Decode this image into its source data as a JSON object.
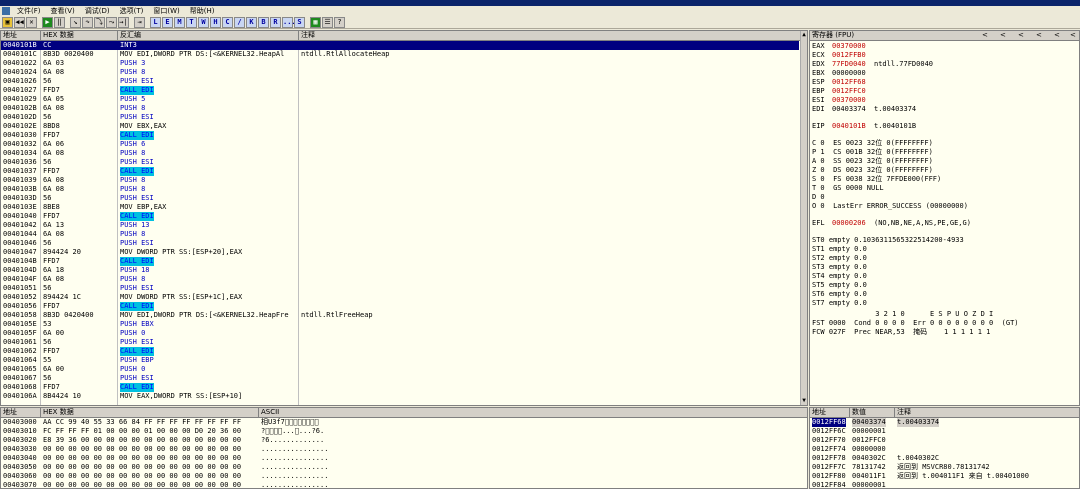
{
  "menu": {
    "items": [
      "文件(F)",
      "查看(V)",
      "调试(D)",
      "选项(T)",
      "窗口(W)",
      "帮助(H)"
    ]
  },
  "toolbar": {
    "letters": [
      "L",
      "E",
      "M",
      "T",
      "W",
      "H",
      "C",
      "/",
      "K",
      "B",
      "R",
      "...",
      "S"
    ]
  },
  "disasm": {
    "headers": [
      "地址",
      "HEX 数据",
      "反汇编",
      "注释"
    ],
    "rows": [
      {
        "addr": "0040101B",
        "hex": "CC",
        "asm": "INT3",
        "comment": "",
        "selected": true
      },
      {
        "addr": "0040101C",
        "hex": "8B3D 0020400",
        "asm": "MOV EDI,DWORD PTR DS:[<&KERNEL32.HeapAl",
        "comment": "ntdll.RtlAllocateHeap"
      },
      {
        "addr": "00401022",
        "hex": "6A 03",
        "asm": "PUSH 3",
        "comment": ""
      },
      {
        "addr": "00401024",
        "hex": "6A 08",
        "asm": "PUSH 8",
        "comment": ""
      },
      {
        "addr": "00401026",
        "hex": "56",
        "asm": "PUSH ESI",
        "comment": ""
      },
      {
        "addr": "00401027",
        "hex": "FFD7",
        "asm": "CALL EDI",
        "comment": ""
      },
      {
        "addr": "00401029",
        "hex": "6A 05",
        "asm": "PUSH 5",
        "comment": ""
      },
      {
        "addr": "0040102B",
        "hex": "6A 08",
        "asm": "PUSH 8",
        "comment": ""
      },
      {
        "addr": "0040102D",
        "hex": "56",
        "asm": "PUSH ESI",
        "comment": ""
      },
      {
        "addr": "0040102E",
        "hex": "8BD8",
        "asm": "MOV EBX,EAX",
        "comment": ""
      },
      {
        "addr": "00401030",
        "hex": "FFD7",
        "asm": "CALL EDI",
        "comment": ""
      },
      {
        "addr": "00401032",
        "hex": "6A 06",
        "asm": "PUSH 6",
        "comment": ""
      },
      {
        "addr": "00401034",
        "hex": "6A 08",
        "asm": "PUSH 8",
        "comment": ""
      },
      {
        "addr": "00401036",
        "hex": "56",
        "asm": "PUSH ESI",
        "comment": ""
      },
      {
        "addr": "00401037",
        "hex": "FFD7",
        "asm": "CALL EDI",
        "comment": ""
      },
      {
        "addr": "00401039",
        "hex": "6A 08",
        "asm": "PUSH 8",
        "comment": ""
      },
      {
        "addr": "0040103B",
        "hex": "6A 08",
        "asm": "PUSH 8",
        "comment": ""
      },
      {
        "addr": "0040103D",
        "hex": "56",
        "asm": "PUSH ESI",
        "comment": ""
      },
      {
        "addr": "0040103E",
        "hex": "8BE8",
        "asm": "MOV EBP,EAX",
        "comment": ""
      },
      {
        "addr": "00401040",
        "hex": "FFD7",
        "asm": "CALL EDI",
        "comment": ""
      },
      {
        "addr": "00401042",
        "hex": "6A 13",
        "asm": "PUSH 13",
        "comment": ""
      },
      {
        "addr": "00401044",
        "hex": "6A 08",
        "asm": "PUSH 8",
        "comment": ""
      },
      {
        "addr": "00401046",
        "hex": "56",
        "asm": "PUSH ESI",
        "comment": ""
      },
      {
        "addr": "00401047",
        "hex": "894424 20",
        "asm": "MOV DWORD PTR SS:[ESP+20],EAX",
        "comment": ""
      },
      {
        "addr": "0040104B",
        "hex": "FFD7",
        "asm": "CALL EDI",
        "comment": ""
      },
      {
        "addr": "0040104D",
        "hex": "6A 18",
        "asm": "PUSH 18",
        "comment": ""
      },
      {
        "addr": "0040104F",
        "hex": "6A 08",
        "asm": "PUSH 8",
        "comment": ""
      },
      {
        "addr": "00401051",
        "hex": "56",
        "asm": "PUSH ESI",
        "comment": ""
      },
      {
        "addr": "00401052",
        "hex": "894424 1C",
        "asm": "MOV DWORD PTR SS:[ESP+1C],EAX",
        "comment": ""
      },
      {
        "addr": "00401056",
        "hex": "FFD7",
        "asm": "CALL EDI",
        "comment": ""
      },
      {
        "addr": "00401058",
        "hex": "8B3D 0420400",
        "asm": "MOV EDI,DWORD PTR DS:[<&KERNEL32.HeapFre",
        "comment": "ntdll.RtlFreeHeap"
      },
      {
        "addr": "0040105E",
        "hex": "53",
        "asm": "PUSH EBX",
        "comment": ""
      },
      {
        "addr": "0040105F",
        "hex": "6A 00",
        "asm": "PUSH 0",
        "comment": ""
      },
      {
        "addr": "00401061",
        "hex": "56",
        "asm": "PUSH ESI",
        "comment": ""
      },
      {
        "addr": "00401062",
        "hex": "FFD7",
        "asm": "CALL EDI",
        "comment": ""
      },
      {
        "addr": "00401064",
        "hex": "55",
        "asm": "PUSH EBP",
        "comment": ""
      },
      {
        "addr": "00401065",
        "hex": "6A 00",
        "asm": "PUSH 0",
        "comment": ""
      },
      {
        "addr": "00401067",
        "hex": "56",
        "asm": "PUSH ESI",
        "comment": ""
      },
      {
        "addr": "00401068",
        "hex": "FFD7",
        "asm": "CALL EDI",
        "comment": ""
      },
      {
        "addr": "0040106A",
        "hex": "8B4424 10",
        "asm": "MOV EAX,DWORD PTR SS:[ESP+10]",
        "comment": ""
      }
    ]
  },
  "registers": {
    "header": "寄存器 (FPU)",
    "nav": [
      "<",
      "<",
      "<",
      "<",
      "<",
      "<"
    ],
    "gp": [
      {
        "name": "EAX",
        "value": "00370000",
        "extra": "",
        "changed": true
      },
      {
        "name": "ECX",
        "value": "0012FFB0",
        "extra": "",
        "changed": true
      },
      {
        "name": "EDX",
        "value": "77FD0040",
        "extra": "ntdll.77FD0040",
        "changed": true
      },
      {
        "name": "EBX",
        "value": "00000000",
        "extra": "",
        "changed": false
      },
      {
        "name": "ESP",
        "value": "0012FF68",
        "extra": "",
        "changed": true
      },
      {
        "name": "EBP",
        "value": "0012FFC0",
        "extra": "",
        "changed": true
      },
      {
        "name": "ESI",
        "value": "00370000",
        "extra": "",
        "changed": true
      },
      {
        "name": "EDI",
        "value": "00403374",
        "extra": "t.00403374",
        "changed": false
      }
    ],
    "eip": {
      "name": "EIP",
      "value": "0040101B",
      "extra": "t.0040101B"
    },
    "flags": [
      "C 0  ES 0023 32位 0(FFFFFFFF)",
      "P 1  CS 001B 32位 0(FFFFFFFF)",
      "A 0  SS 0023 32位 0(FFFFFFFF)",
      "Z 0  DS 0023 32位 0(FFFFFFFF)",
      "S 0  FS 0038 32位 7FFDE000(FFF)",
      "T 0  GS 0000 NULL",
      "D 0",
      "O 0  LastErr ERROR_SUCCESS (00000000)"
    ],
    "efl": {
      "name": "EFL",
      "value": "00000206",
      "extra": "(NO,NB,NE,A,NS,PE,GE,G)"
    },
    "fpu": [
      "ST0 empty 0.1036311565322514200-4933",
      "ST1 empty 0.0",
      "ST2 empty 0.0",
      "ST3 empty 0.0",
      "ST4 empty 0.0",
      "ST5 empty 0.0",
      "ST6 empty 0.0",
      "ST7 empty 0.0"
    ],
    "fpu_bits_header": "               3 2 1 0      E S P U O Z D I",
    "fst": "FST 0000  Cond 0 0 0 0  Err 0 0 0 0 0 0 0 0  (GT)",
    "fcw": "FCW 027F  Prec NEAR,53  掩码    1 1 1 1 1 1"
  },
  "dump": {
    "headers": [
      "地址",
      "HEX 数据",
      "ASCII"
    ],
    "rows": [
      {
        "addr": "00403000",
        "hex": "AA CC 99 40 55 33 66 84 FF FF FF FF FF FF FF FF",
        "ascii": "相U3f7\u0000\u0000\u0000\u0000\u0000\u0000\u0000\u0000"
      },
      {
        "addr": "00403010",
        "hex": "FC FF FF FF 01 00 00 00 01 00 00 00 D0 20 36 00",
        "ascii": "?\u0000\u0000\u0000\u0001...\u0001...?6."
      },
      {
        "addr": "00403020",
        "hex": "E8 39 36 00 00 00 00 00 00 00 00 00 00 00 00 00",
        "ascii": "?6............."
      },
      {
        "addr": "00403030",
        "hex": "00 00 00 00 00 00 00 00 00 00 00 00 00 00 00 00",
        "ascii": "................"
      },
      {
        "addr": "00403040",
        "hex": "00 00 00 00 00 00 00 00 00 00 00 00 00 00 00 00",
        "ascii": "................"
      },
      {
        "addr": "00403050",
        "hex": "00 00 00 00 00 00 00 00 00 00 00 00 00 00 00 00",
        "ascii": "................"
      },
      {
        "addr": "00403060",
        "hex": "00 00 00 00 00 00 00 00 00 00 00 00 00 00 00 00",
        "ascii": "................"
      },
      {
        "addr": "00403070",
        "hex": "00 00 00 00 00 00 00 00 00 00 00 00 00 00 00 00",
        "ascii": "................"
      }
    ]
  },
  "stack": {
    "headers": [
      "地址",
      "数值",
      "注释"
    ],
    "rows": [
      {
        "addr": "0012FF68",
        "value": "00403374",
        "comment": "t.00403374",
        "selected": true
      },
      {
        "addr": "0012FF6C",
        "value": "00000001",
        "comment": ""
      },
      {
        "addr": "0012FF70",
        "value": "0012FFC0",
        "comment": ""
      },
      {
        "addr": "0012FF74",
        "value": "00000000",
        "comment": ""
      },
      {
        "addr": "0012FF78",
        "value": "0040302C",
        "comment": "t.0040302C"
      },
      {
        "addr": "0012FF7C",
        "value": "78131742",
        "comment": "返回到 MSVCR80.78131742"
      },
      {
        "addr": "0012FF80",
        "value": "004011F1",
        "comment": "返回到 t.004011F1 来自 t.00401000"
      },
      {
        "addr": "0012FF84",
        "value": "00000001",
        "comment": ""
      }
    ]
  }
}
